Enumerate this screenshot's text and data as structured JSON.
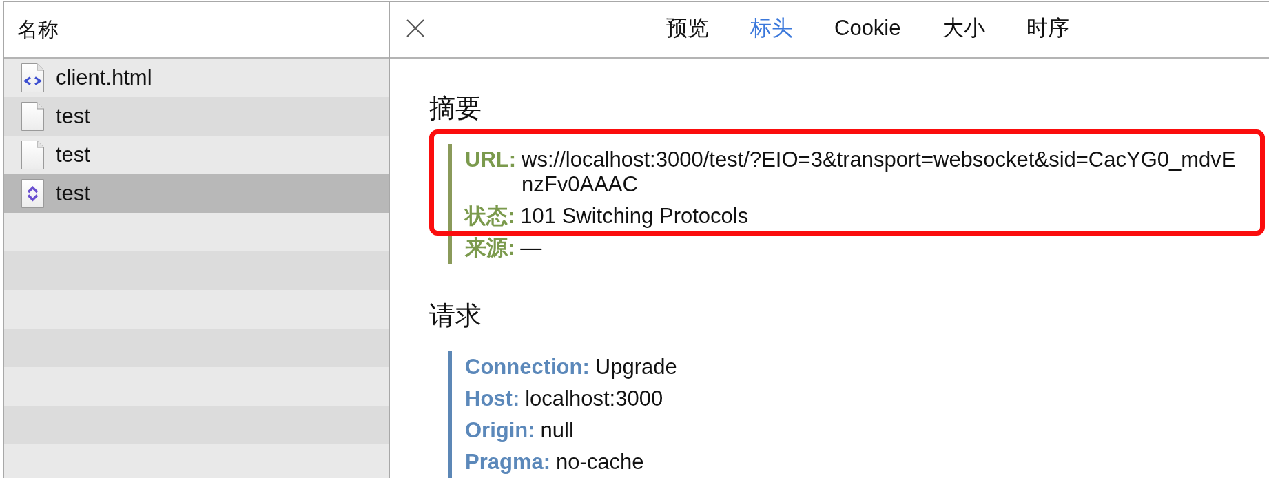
{
  "sidebar": {
    "column_header": "名称",
    "files": [
      {
        "name": "client.html",
        "kind": "html",
        "selected": false
      },
      {
        "name": "test",
        "kind": "plain",
        "selected": false
      },
      {
        "name": "test",
        "kind": "plain",
        "selected": false
      },
      {
        "name": "test",
        "kind": "websocket",
        "selected": true
      }
    ]
  },
  "detail": {
    "tabs": [
      {
        "label": "预览",
        "selected": false
      },
      {
        "label": "标头",
        "selected": true
      },
      {
        "label": "Cookie",
        "selected": false
      },
      {
        "label": "大小",
        "selected": false
      },
      {
        "label": "时序",
        "selected": false
      }
    ],
    "sections": [
      {
        "title": "摘要",
        "kind": "summary",
        "groups": [
          {
            "kind": "highlight",
            "items": [
              {
                "label": "URL:",
                "value": "ws://localhost:3000/test/?EIO=3&transport=websocket&sid=CacYG0_mdvEnzFv0AAAC"
              },
              {
                "label": "状态:",
                "value": "101 Switching Protocols"
              }
            ]
          },
          {
            "kind": "plain",
            "items": [
              {
                "label": "来源:",
                "value": "—"
              }
            ]
          }
        ]
      },
      {
        "title": "请求",
        "kind": "request",
        "groups": [
          {
            "kind": "plain",
            "items": [
              {
                "label": "Connection:",
                "value": "Upgrade"
              },
              {
                "label": "Host:",
                "value": "localhost:3000"
              },
              {
                "label": "Origin:",
                "value": "null"
              },
              {
                "label": "Pragma:",
                "value": "no-cache"
              }
            ]
          }
        ]
      }
    ]
  }
}
